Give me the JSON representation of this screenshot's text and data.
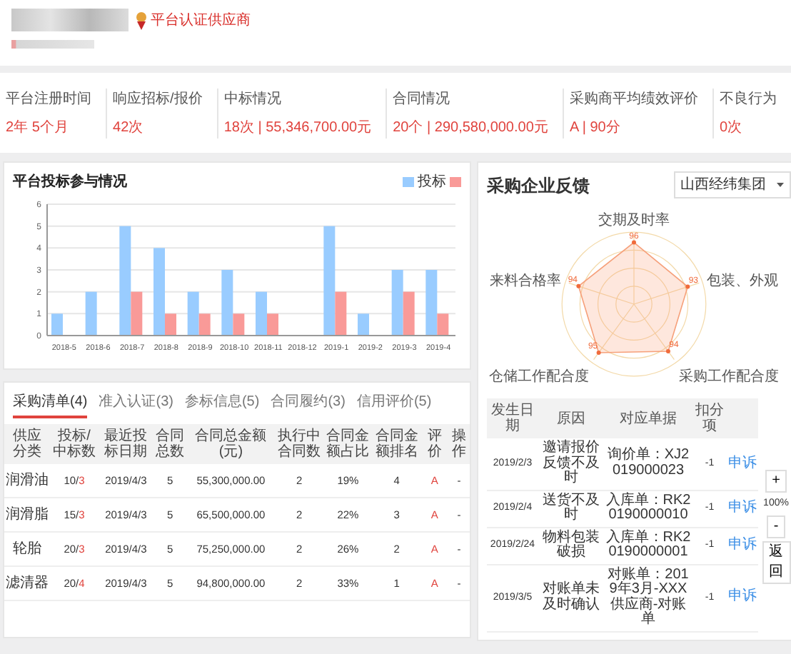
{
  "header": {
    "badge": "平台认证供应商"
  },
  "stats": [
    {
      "label": "平台注册时间",
      "value": "2年 5个月"
    },
    {
      "label": "响应招标/报价",
      "value": "42次"
    },
    {
      "label": "中标情况",
      "value": "18次 | 55,346,700.00元"
    },
    {
      "label": "合同情况",
      "value": "20个 | 290,580,000.00元"
    },
    {
      "label": "采购商平均绩效评价",
      "value": "A | 90分"
    },
    {
      "label": "不良行为",
      "value": "0次"
    }
  ],
  "bid_chart": {
    "title": "平台投标参与情况",
    "chart_data": {
      "type": "bar",
      "categories": [
        "2018-5",
        "2018-6",
        "2018-7",
        "2018-8",
        "2018-9",
        "2018-10",
        "2018-11",
        "2018-12",
        "2019-1",
        "2019-2",
        "2019-3",
        "2019-4"
      ],
      "ylim": [
        0,
        6
      ],
      "grid": true,
      "yticks": [
        0,
        1,
        2,
        3,
        4,
        5,
        6
      ],
      "series": [
        {
          "name": "投标",
          "color": "#99ccff",
          "values": [
            1,
            2,
            5,
            4,
            2,
            3,
            2,
            0,
            5,
            1,
            3,
            3
          ]
        },
        {
          "color": "#f99a98",
          "values": [
            0,
            0,
            2,
            1,
            1,
            1,
            1,
            0,
            2,
            0,
            2,
            1
          ]
        }
      ]
    }
  },
  "supply_table": {
    "tabs": [
      {
        "label": "采购清单(4)",
        "selected": true
      },
      {
        "label": "准入认证(3)",
        "selected": false
      },
      {
        "label": "参标信息(5)",
        "selected": false
      },
      {
        "label": "合同履约(3)",
        "selected": false
      },
      {
        "label": "信用评价(5)",
        "selected": false
      }
    ],
    "columns": [
      "供应分类",
      "投标/中标数",
      "最近投标日期",
      "合同总数",
      "合同总金额(元)",
      "执行中合同数",
      "合同金额占比",
      "合同金额排名",
      "评价",
      "操作"
    ],
    "rows": [
      {
        "category": "润滑油",
        "bids": "10/",
        "wins": "3",
        "date": "2019/4/3",
        "contracts": "5",
        "amount": "55,300,000.00",
        "active": "2",
        "share": "19%",
        "rank": "4",
        "grade": "A",
        "op": "-"
      },
      {
        "category": "润滑脂",
        "bids": "15/",
        "wins": "3",
        "date": "2019/4/3",
        "contracts": "5",
        "amount": "65,500,000.00",
        "active": "2",
        "share": "22%",
        "rank": "3",
        "grade": "A",
        "op": "-"
      },
      {
        "category": "轮胎",
        "bids": "20/",
        "wins": "3",
        "date": "2019/4/3",
        "contracts": "5",
        "amount": "75,250,000.00",
        "active": "2",
        "share": "26%",
        "rank": "2",
        "grade": "A",
        "op": "-"
      },
      {
        "category": "滤清器",
        "bids": "20/",
        "wins": "4",
        "date": "2019/4/3",
        "contracts": "5",
        "amount": "94,800,000.00",
        "active": "2",
        "share": "33%",
        "rank": "1",
        "grade": "A",
        "op": "-"
      }
    ]
  },
  "feedback": {
    "title": "采购企业反馈",
    "select": "山西经纬集团",
    "radar": [
      {
        "label": "交期及时率",
        "value": "96"
      },
      {
        "label": "来料合格率",
        "value": "94"
      },
      {
        "label": "包装、外观",
        "value": "93"
      },
      {
        "label": "仓储工作配合度",
        "value": "95"
      },
      {
        "label": "采购工作配合度",
        "value": "94"
      }
    ],
    "columns": [
      "发生日期",
      "原因",
      "对应单据",
      "扣分项",
      ""
    ],
    "rows": [
      {
        "date": "2019/2/3",
        "reason": "邀请报价反馈不及时",
        "doc": "询价单：XJ2019000023",
        "points": "-1",
        "action": "申诉"
      },
      {
        "date": "2019/2/4",
        "reason": "送货不及时",
        "doc": "入库单：RK20190000010",
        "points": "-1",
        "action": "申诉"
      },
      {
        "date": "2019/2/24",
        "reason": "物料包装破损",
        "doc": "入库单：RK20190000001",
        "points": "-1",
        "action": "申诉"
      },
      {
        "date": "2019/3/5",
        "reason": "对账单未及时确认",
        "doc": "对账单：2019年3月-XXX供应商-对账单",
        "points": "-1",
        "action": "申诉"
      }
    ],
    "zoom": {
      "plus": "+",
      "level": "100%",
      "minus": "-",
      "back": "返回"
    }
  }
}
